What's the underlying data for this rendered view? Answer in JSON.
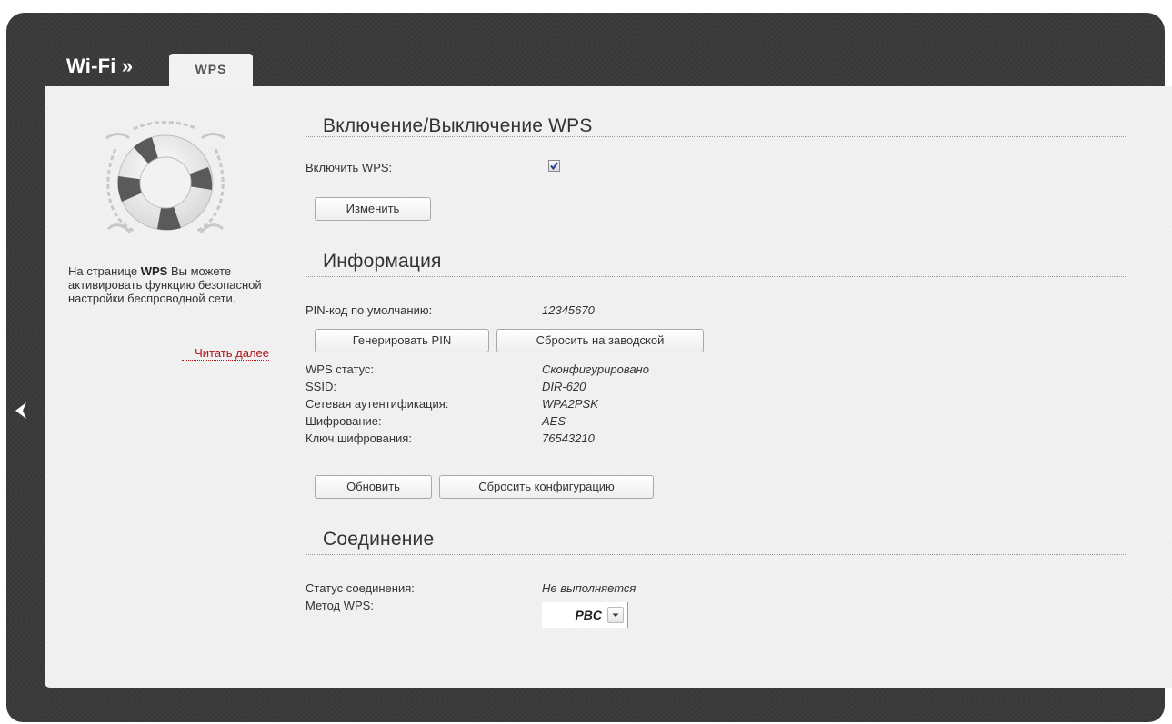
{
  "header": {
    "title": "Wi-Fi »",
    "tab_label": "WPS"
  },
  "sidebar": {
    "help_prefix": "На странице ",
    "help_bold": "WPS",
    "help_suffix": " Вы можете активировать функцию безопасной настройки беспроводной сети.",
    "read_more": "Читать далее"
  },
  "sections": {
    "enable": {
      "title": "Включение/Выключение WPS",
      "enable_label": "Включить WPS:",
      "enable_checked": true,
      "change_button": "Изменить"
    },
    "info": {
      "title": "Информация",
      "pin_label": "PIN-код по умолчанию:",
      "pin_value": "12345670",
      "generate_pin_button": "Генерировать PIN",
      "factory_reset_button": "Сбросить на заводской",
      "status_label": "WPS статус:",
      "status_value": "Сконфигурировано",
      "ssid_label": "SSID:",
      "ssid_value": "DIR-620",
      "auth_label": "Сетевая аутентификация:",
      "auth_value": "WPA2PSK",
      "encryption_label": "Шифрование:",
      "encryption_value": "AES",
      "key_label": "Ключ шифрования:",
      "key_value": "76543210",
      "refresh_button": "Обновить",
      "reset_config_button": "Сбросить конфигурацию"
    },
    "connection": {
      "title": "Соединение",
      "status_label": "Статус соединения:",
      "status_value": "Не выполняется",
      "method_label": "Метод WPS:",
      "method_value": "PBC"
    }
  },
  "colors": {
    "frame_bg": "#3a3a3a",
    "panel_bg": "#f2f2f2",
    "link_red": "#b0121a"
  }
}
